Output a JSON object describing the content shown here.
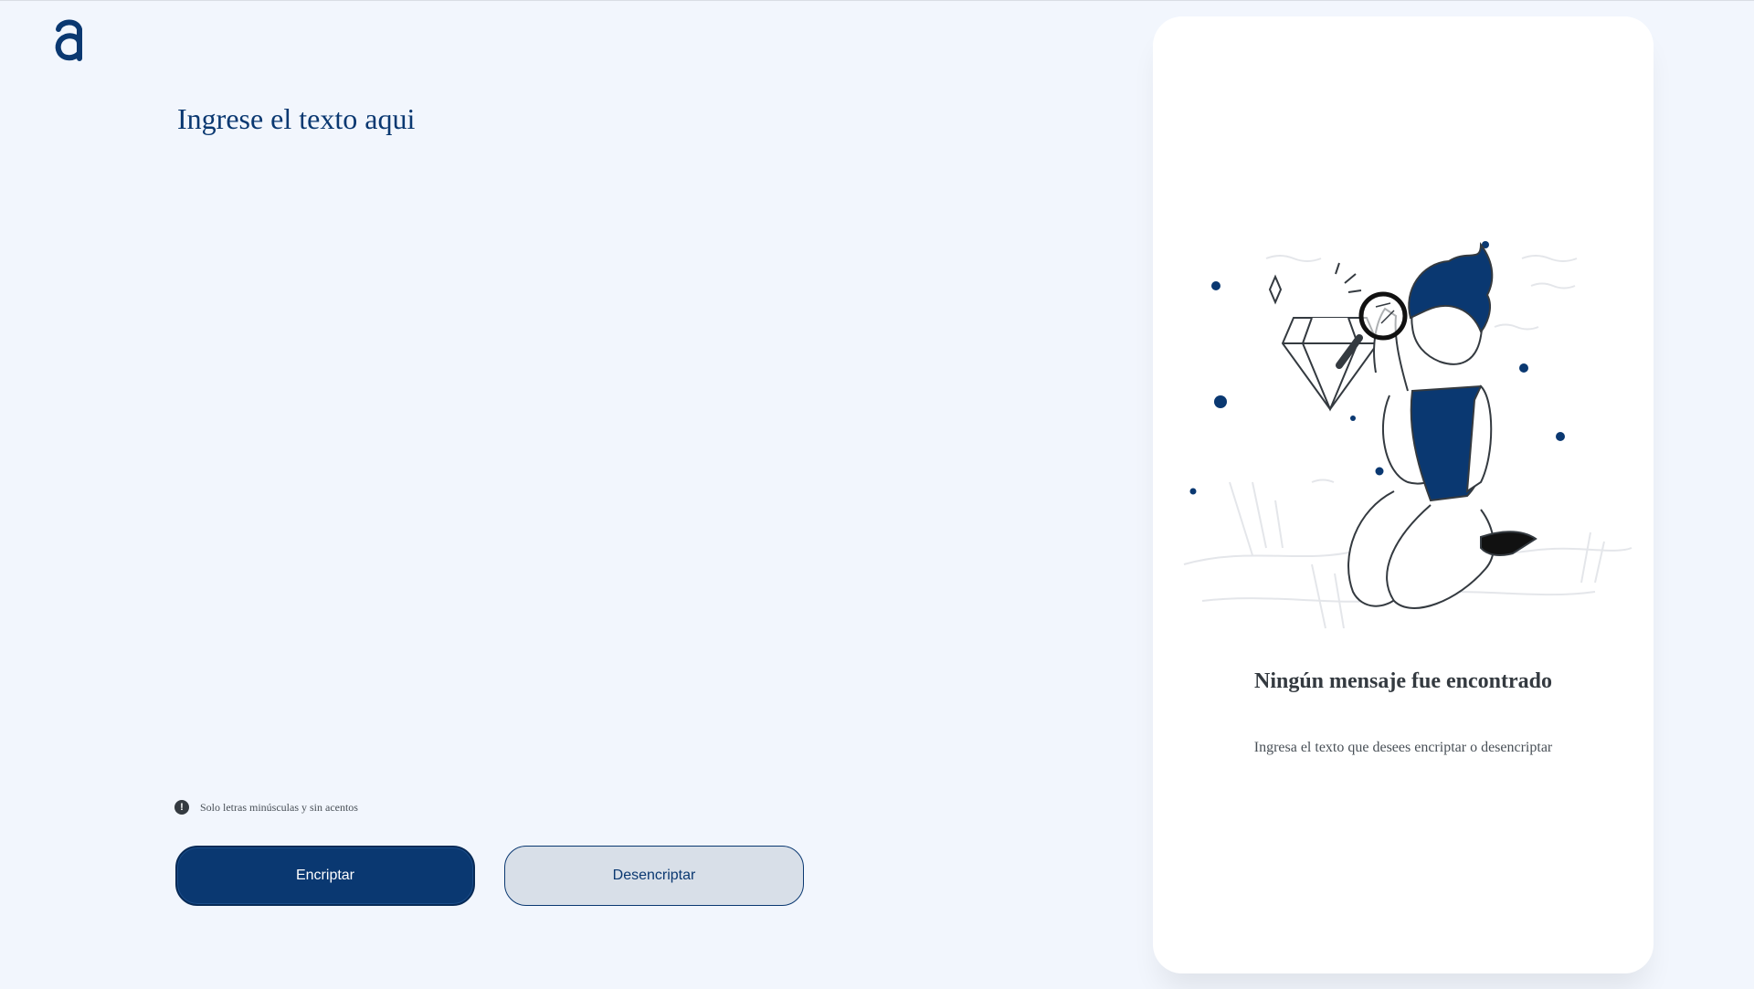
{
  "header": {
    "logo_icon": "alura-a-logo-icon"
  },
  "input": {
    "placeholder": "Ingrese el texto aqui",
    "value": ""
  },
  "hint": {
    "icon": "exclamation-circle-icon",
    "text": "Solo letras minúsculas y sin acentos"
  },
  "buttons": {
    "encrypt_label": "Encriptar",
    "decrypt_label": "Desencriptar"
  },
  "output_panel": {
    "illustration": "person-with-magnifying-glass-and-diamond-illustration",
    "title": "Ningún mensaje fue encontrado",
    "subtitle": "Ingresa el texto que desees encriptar o desencriptar"
  },
  "colors": {
    "background": "#f2f6fd",
    "primary": "#0a3871",
    "secondary_button": "#d8dfe8",
    "panel": "#ffffff",
    "title_text": "#343a40"
  }
}
